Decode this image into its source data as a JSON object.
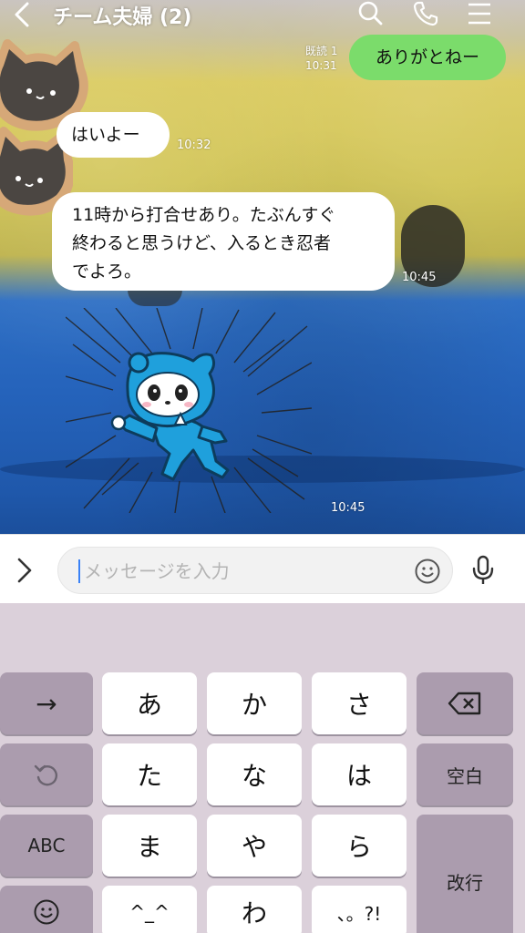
{
  "header": {
    "title": "チーム夫婦 (2)",
    "icons": [
      "back-icon",
      "search-icon",
      "phone-icon",
      "menu-icon"
    ]
  },
  "messages": {
    "sent": {
      "text": "ありがとねー",
      "read": "既読 1",
      "time": "10:31"
    },
    "received": [
      {
        "text": "はいよー",
        "time": "10:32"
      },
      {
        "lines": [
          "11時から打合せあり。たぶんすぐ",
          "終わると思うけど、入るとき忍者",
          "でよろ。"
        ],
        "time": "10:45"
      },
      {
        "sticker": "ninja-panda-sticker",
        "time": "10:45"
      }
    ]
  },
  "input": {
    "placeholder": "メッセージを入力",
    "icons": [
      "chevron-right-icon",
      "emoji-icon",
      "microphone-icon"
    ]
  },
  "keyboard": {
    "row1": [
      "→",
      "あ",
      "か",
      "さ"
    ],
    "row2": [
      "た",
      "な",
      "は",
      "空白"
    ],
    "row3": [
      "ABC",
      "ま",
      "や",
      "ら",
      "改行"
    ],
    "row4": [
      "^_^",
      "わ",
      "、。?!"
    ],
    "icons": [
      "backspace-icon",
      "undo-icon",
      "emoji-keyboard-icon"
    ]
  },
  "colors": {
    "sent_bubble": "#7bdc6b",
    "received_bubble": "#ffffff",
    "keyboard_bg": "#dbd0da",
    "fn_key": "#ab9cae",
    "caret": "#3b82f6"
  }
}
